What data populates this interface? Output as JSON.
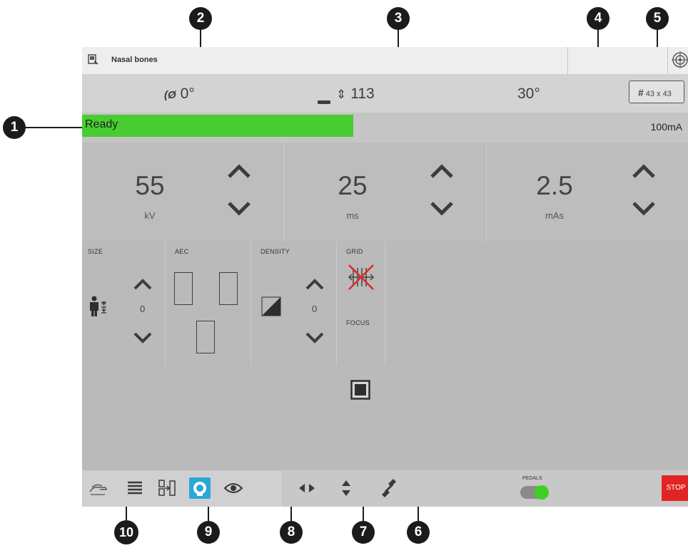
{
  "titlebar": {
    "title": "Nasal bones",
    "icon": "xray-icon",
    "target_icon": "target-icon"
  },
  "info": {
    "angle1_icon": "(Ø",
    "angle1": "0°",
    "height_icon": "height-icon",
    "height": "113",
    "angle2": "30°",
    "detector_icon": "#",
    "detector": "43 x 43"
  },
  "status": {
    "text": "Ready",
    "color": "#49cc32",
    "ma": "100mA"
  },
  "params": [
    {
      "value": "55",
      "unit": "kV"
    },
    {
      "value": "25",
      "unit": "ms"
    },
    {
      "value": "2.5",
      "unit": "mAs"
    }
  ],
  "settings": {
    "size_label": "SIZE",
    "size_value": "0",
    "aec_label": "AEC",
    "density_label": "DENSITY",
    "density_value": "0",
    "grid_label": "GRID",
    "focus_label": "FOCUS"
  },
  "toolbar": {
    "icons": [
      "hand-icon",
      "list-icon",
      "split-icon",
      "patient-icon",
      "eye-icon",
      "horizontal-move-icon",
      "vertical-move-icon",
      "tilt-icon"
    ],
    "pedals_label": "PEDALS",
    "stop_label": "STOP"
  },
  "callouts": [
    "1",
    "2",
    "3",
    "4",
    "5",
    "6",
    "7",
    "8",
    "9",
    "10"
  ]
}
